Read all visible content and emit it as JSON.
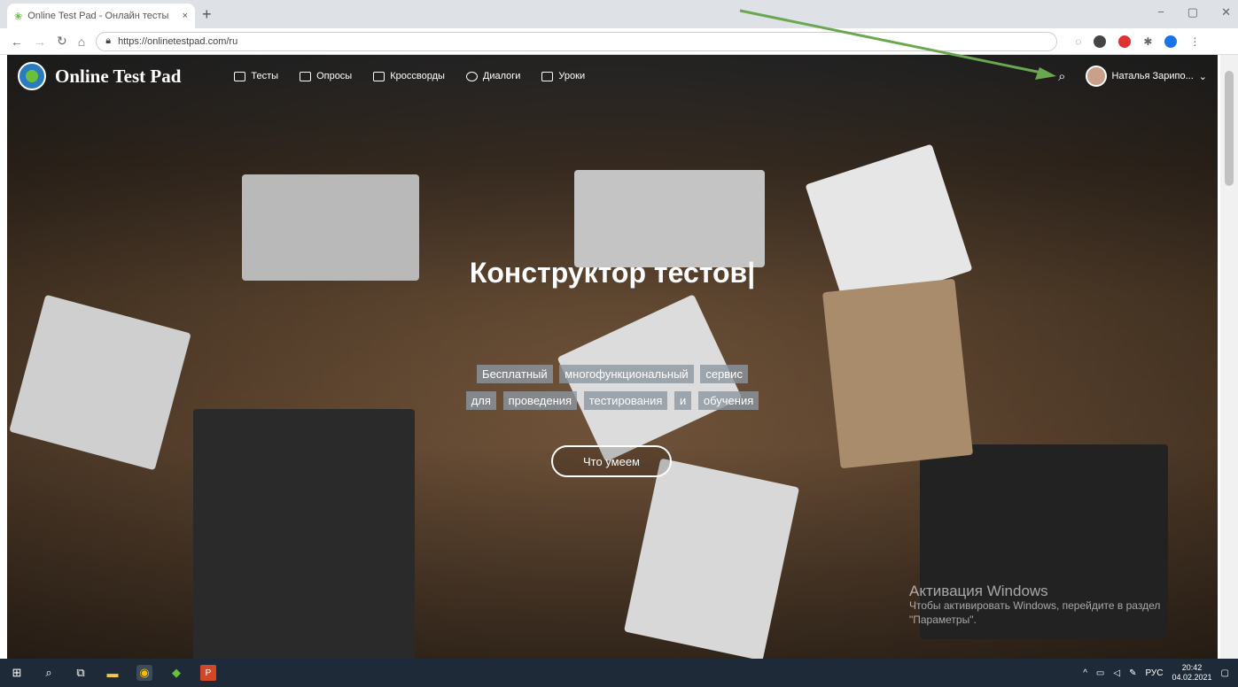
{
  "browser": {
    "tab_title": "Online Test Pad - Онлайн тесты",
    "tab_close": "×",
    "new_tab": "+",
    "url": "https://onlinetestpad.com/ru",
    "win_minimize": "−",
    "win_maximize": "▢",
    "win_close": "✕"
  },
  "site": {
    "logo_text": "Online Test Pad",
    "nav": [
      {
        "label": "Тесты",
        "icon": "test-icon"
      },
      {
        "label": "Опросы",
        "icon": "survey-icon"
      },
      {
        "label": "Кроссворды",
        "icon": "crossword-icon"
      },
      {
        "label": "Диалоги",
        "icon": "dialog-icon"
      },
      {
        "label": "Уроки",
        "icon": "lesson-icon"
      }
    ],
    "user_name": "Наталья Зарипо...",
    "user_caret": "⌄",
    "headline": "Конструктор тестов|",
    "subtitle_line1": [
      "Бесплатный",
      "многофункциональный",
      "сервис"
    ],
    "subtitle_line2": [
      "для",
      "проведения",
      "тестирования",
      "и",
      "обучения"
    ],
    "cta_label": "Что умеем"
  },
  "windows_watermark": {
    "title": "Активация Windows",
    "line1": "Чтобы активировать Windows, перейдите в раздел",
    "line2": "\"Параметры\"."
  },
  "taskbar": {
    "lang": "РУС",
    "time": "20:42",
    "date": "04.02.2021"
  },
  "colors": {
    "annotation_arrow": "#6aa84f",
    "taskbar": "#1e2a38"
  }
}
